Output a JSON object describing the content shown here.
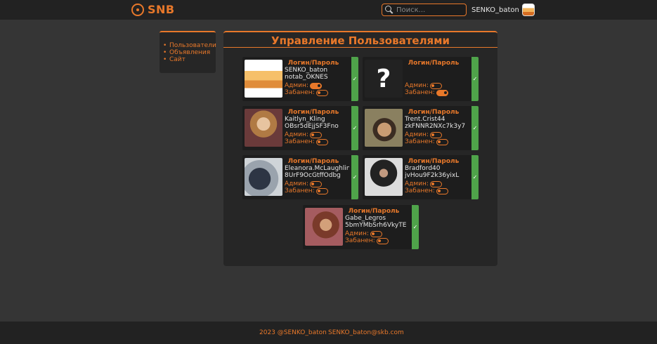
{
  "header": {
    "logo_text": "SNB",
    "search_placeholder": "Поиск...",
    "username": "SENKO_baton"
  },
  "sidebar": {
    "items": [
      {
        "label": "Пользователи"
      },
      {
        "label": "Объявления"
      },
      {
        "label": "Сайт"
      }
    ]
  },
  "panel": {
    "title": "Управление Пользователями"
  },
  "users": [
    {
      "head": "Логин/Пароль",
      "login": "SENKO_baton",
      "password": "notab_OKNES",
      "admin_label": "Админ:",
      "admin": true,
      "ban_label": "Забанен:",
      "banned": false,
      "save_icon": "✓",
      "photo": "cat-bread-avatar"
    },
    {
      "head": "Логин/Пароль",
      "login": "",
      "password": "",
      "admin_label": "Админ:",
      "admin": false,
      "ban_label": "Забанен:",
      "banned": true,
      "save_icon": "✓",
      "photo": "question-mark-avatar",
      "photo_glyph": "?"
    },
    {
      "head": "Логин/Пароль",
      "login": "Kaitlyn_Kling",
      "password": "OBsr5dEjjSF3Fno",
      "admin_label": "Админ:",
      "admin": false,
      "ban_label": "Забанен:",
      "banned": false,
      "save_icon": "✓",
      "photo": "blonde-woman-photo"
    },
    {
      "head": "Логин/Пароль",
      "login": "Trent.Crist44",
      "password": "zkFNNR2NXc7k3y7",
      "admin_label": "Админ:",
      "admin": false,
      "ban_label": "Забанен:",
      "banned": false,
      "save_icon": "✓",
      "photo": "man-in-hat-photo"
    },
    {
      "head": "Логин/Пароль",
      "login": "Eleanora.McLaughlin",
      "password": "8UrF9OcGtffOdbg",
      "admin_label": "Админ:",
      "admin": false,
      "ban_label": "Забанен:",
      "banned": false,
      "save_icon": "✓",
      "photo": "shirt-photo"
    },
    {
      "head": "Логин/Пароль",
      "login": "Bradford40",
      "password": "jvHou9F2k36yixL",
      "admin_label": "Админ:",
      "admin": false,
      "ban_label": "Забанен:",
      "banned": false,
      "save_icon": "✓",
      "photo": "man-with-phone-photo"
    },
    {
      "head": "Логин/Пароль",
      "login": "Gabe_Legros",
      "password": "5bmYMbSrh6VkyTE",
      "admin_label": "Админ:",
      "admin": false,
      "ban_label": "Забанен:",
      "banned": false,
      "save_icon": "✓",
      "photo": "woman-portrait-photo"
    }
  ],
  "footer": {
    "copyright": "2023 @SENKO_baton",
    "email": "SENKO_baton@skb.com"
  },
  "colors": {
    "accent": "#e8782a",
    "save": "#4fa34a",
    "background": "#353535",
    "panel": "#262626"
  }
}
